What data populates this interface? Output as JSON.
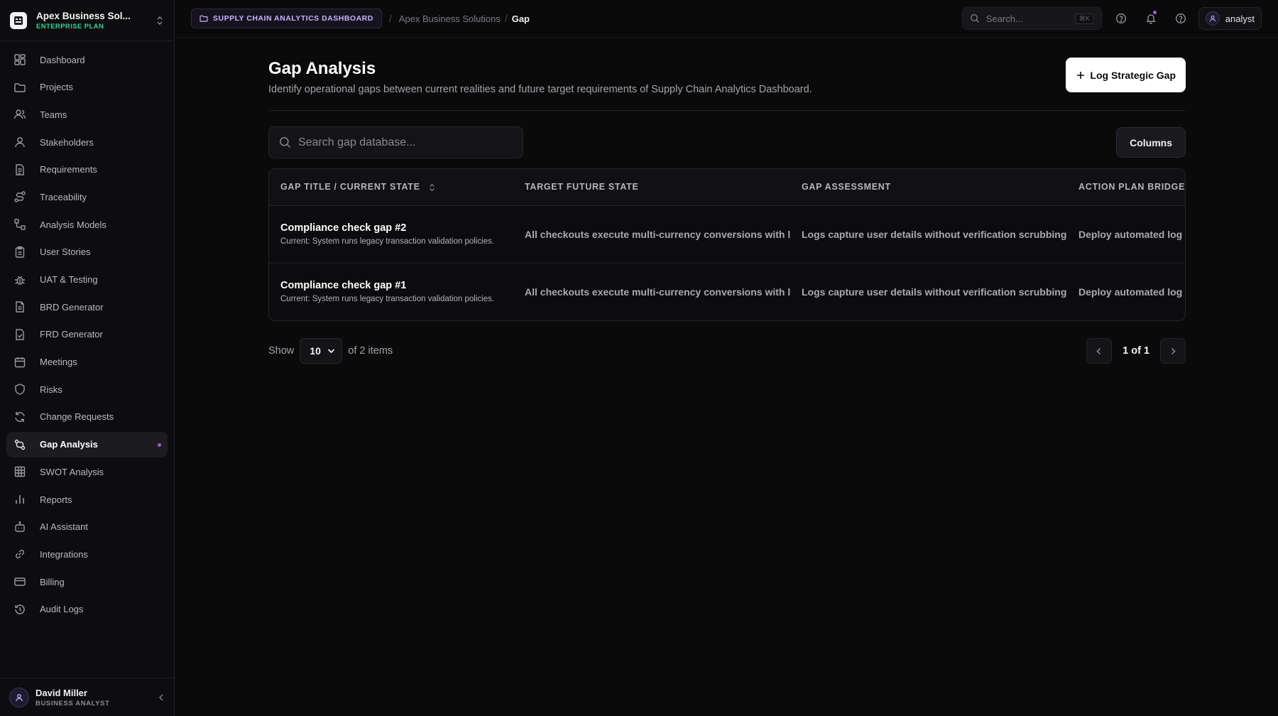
{
  "org": {
    "name": "Apex Business Sol...",
    "plan": "ENTERPRISE PLAN"
  },
  "sidebar": {
    "items": [
      {
        "label": "Dashboard",
        "icon": "dashboard-icon"
      },
      {
        "label": "Projects",
        "icon": "folder-icon"
      },
      {
        "label": "Teams",
        "icon": "users-icon"
      },
      {
        "label": "Stakeholders",
        "icon": "user-icon"
      },
      {
        "label": "Requirements",
        "icon": "file-text-icon"
      },
      {
        "label": "Traceability",
        "icon": "route-icon"
      },
      {
        "label": "Analysis Models",
        "icon": "workflow-icon"
      },
      {
        "label": "User Stories",
        "icon": "clipboard-icon"
      },
      {
        "label": "UAT & Testing",
        "icon": "bug-icon"
      },
      {
        "label": "BRD Generator",
        "icon": "document-icon"
      },
      {
        "label": "FRD Generator",
        "icon": "file-check-icon"
      },
      {
        "label": "Meetings",
        "icon": "calendar-icon"
      },
      {
        "label": "Risks",
        "icon": "shield-icon"
      },
      {
        "label": "Change Requests",
        "icon": "refresh-icon"
      },
      {
        "label": "Gap Analysis",
        "icon": "git-compare-icon",
        "active": true
      },
      {
        "label": "SWOT Analysis",
        "icon": "grid-icon"
      },
      {
        "label": "Reports",
        "icon": "bar-chart-icon"
      },
      {
        "label": "AI Assistant",
        "icon": "bot-icon"
      },
      {
        "label": "Integrations",
        "icon": "link-icon"
      },
      {
        "label": "Billing",
        "icon": "credit-card-icon"
      },
      {
        "label": "Audit Logs",
        "icon": "history-icon"
      }
    ]
  },
  "user": {
    "name": "David Miller",
    "role": "BUSINESS ANALYST"
  },
  "topbar": {
    "project_badge": "SUPPLY CHAIN ANALYTICS DASHBOARD",
    "breadcrumb": [
      "Apex Business Solutions",
      "Gap"
    ],
    "search_placeholder": "Search...",
    "search_shortcut": "⌘K",
    "account_name": "analyst"
  },
  "page": {
    "title": "Gap Analysis",
    "subtitle": "Identify operational gaps between current realities and future target requirements of Supply Chain Analytics Dashboard.",
    "primary_action": "Log Strategic Gap",
    "table_search_placeholder": "Search gap database...",
    "columns_button": "Columns"
  },
  "table": {
    "headers": [
      "GAP TITLE / CURRENT STATE",
      "TARGET FUTURE STATE",
      "GAP ASSESSMENT",
      "ACTION PLAN BRIDGE"
    ],
    "rows": [
      {
        "title": "Compliance check gap #2",
        "current": "Current: System runs legacy transaction validation policies.",
        "target": "All checkouts execute multi-currency conversions with lo",
        "assessment": "Logs capture user details without verification scrubbing p",
        "action": "Deploy automated log sc"
      },
      {
        "title": "Compliance check gap #1",
        "current": "Current: System runs legacy transaction validation policies.",
        "target": "All checkouts execute multi-currency conversions with lo",
        "assessment": "Logs capture user details without verification scrubbing p",
        "action": "Deploy automated log sc"
      }
    ]
  },
  "pagination": {
    "show_label": "Show",
    "page_size": "10",
    "items_label": "of 2 items",
    "page_label": "1 of 1"
  },
  "colors": {
    "accent": "#a855f7",
    "plan_green": "#34d399",
    "background": "#0a0a0b"
  }
}
